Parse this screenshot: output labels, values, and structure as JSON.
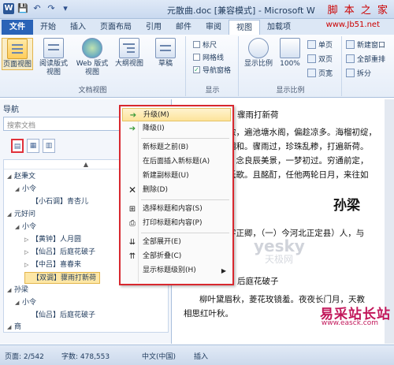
{
  "window": {
    "title": "元散曲.doc [兼容模式] - Microsoft W",
    "watermark_top": "脚 本 之 家",
    "url_top": "www.Jb51.net"
  },
  "quick_access": [
    "W",
    "💾",
    "↶",
    "↷",
    "▾"
  ],
  "tabs": [
    "文件",
    "开始",
    "插入",
    "页面布局",
    "引用",
    "邮件",
    "审阅",
    "视图",
    "加载项"
  ],
  "ribbon": {
    "doc_views": {
      "label": "文档视图",
      "buttons": [
        "页面视图",
        "阅读版式视图",
        "Web 版式视图",
        "大纲视图",
        "草稿"
      ]
    },
    "show": {
      "label": "显示",
      "checks": [
        {
          "label": "标尺",
          "checked": false
        },
        {
          "label": "网格线",
          "checked": false
        },
        {
          "label": "导航窗格",
          "checked": true
        }
      ]
    },
    "zoom": {
      "label": "显示比例",
      "buttons": [
        "显示比例",
        "100%"
      ],
      "small": [
        "单页",
        "双页",
        "页宽"
      ]
    },
    "window": {
      "small": [
        "新建窗口",
        "全部重排",
        "拆分"
      ]
    }
  },
  "nav": {
    "title": "导航",
    "search_placeholder": "搜索文档",
    "tabs": [
      "▤",
      "▦",
      "▥"
    ],
    "tree": [
      {
        "text": "赵秉文",
        "level": 0,
        "twisty": "◢"
      },
      {
        "text": "小令",
        "level": 1,
        "twisty": "◢"
      },
      {
        "text": "【小石调】青杏儿",
        "level": 2,
        "twisty": ""
      },
      {
        "text": "元好问",
        "level": 0,
        "twisty": "◢"
      },
      {
        "text": "小令",
        "level": 1,
        "twisty": "◢"
      },
      {
        "text": "【黄钟】人月圆",
        "level": 2,
        "twisty": "▷"
      },
      {
        "text": "【仙吕】后庭花破子",
        "level": 2,
        "twisty": "▷"
      },
      {
        "text": "【中吕】喜春来",
        "level": 2,
        "twisty": "▷"
      },
      {
        "text": "【双调】骤雨打新荷",
        "level": 2,
        "twisty": "",
        "selected": true
      },
      {
        "text": "孙梁",
        "level": 0,
        "twisty": "◢"
      },
      {
        "text": "小令",
        "level": 1,
        "twisty": "◢"
      },
      {
        "text": "【仙吕】后庭花破子",
        "level": 2,
        "twisty": ""
      },
      {
        "text": "商",
        "level": 0,
        "twisty": "◢"
      }
    ]
  },
  "context_menu": {
    "items": [
      {
        "icon": "➔",
        "label": "升级(M)",
        "hover": true
      },
      {
        "icon": "➔",
        "label": "降级(I)"
      },
      {
        "sep": true
      },
      {
        "icon": "",
        "label": "新标题之前(B)"
      },
      {
        "icon": "",
        "label": "在后面插入新标题(A)"
      },
      {
        "icon": "",
        "label": "新建副标题(U)"
      },
      {
        "icon": "✕",
        "label": "删除(D)"
      },
      {
        "sep": true
      },
      {
        "icon": "⊞",
        "label": "选择标题和内容(S)"
      },
      {
        "icon": "⎙",
        "label": "打印标题和内容(P)"
      },
      {
        "sep": true
      },
      {
        "icon": "⇊",
        "label": "全部展开(E)"
      },
      {
        "icon": "⇈",
        "label": "全部折叠(C)"
      },
      {
        "icon": "",
        "label": "显示标题级别(H)",
        "submenu": true
      }
    ]
  },
  "document": {
    "lines": [
      "骤雨打新荷",
      "浓，遍池塘水阁，偏趁凉多。海榴初绽，",
      "相和。骤雨过，珍珠乱糁，打遍新荷。",
      "，念良辰美景，一梦初过。穷通前定，",
      "低歌。且酩酊，任他两轮日月，来往如",
      "孙梁",
      "字正卿，（一）今河北正定县）人，与",
      "后庭花破子",
      "柳叶黛眉秋，菱花玫镜羞。夜夜长门月，天教",
      "相思红叶秋。"
    ],
    "wm_center": "yesky",
    "wm_center2": "天极网"
  },
  "status": {
    "page": "页面: 2/542",
    "words": "字数: 478,553",
    "lang": "中文(中国)",
    "mode": "插入"
  },
  "watermark_bottom": "易采站长站",
  "watermark_bottom_url": "www.easck.com"
}
